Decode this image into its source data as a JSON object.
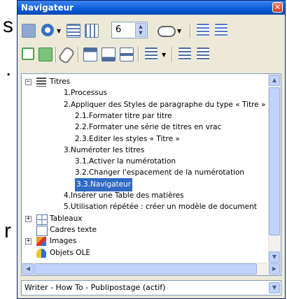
{
  "background_text": [
    "s",
    "r",
    "."
  ],
  "window": {
    "title": "Navigateur",
    "close_glyph": "✕"
  },
  "toolbar": {
    "row1": [
      {
        "name": "navigation-icon",
        "color": "#6c8ebf"
      },
      {
        "name": "navigation-circle-icon",
        "color": "#3a6fc6"
      },
      {
        "name": "headings-list-icon",
        "color": "#5b7fae"
      },
      {
        "name": "headings-grid-icon",
        "color": "#5b7fae"
      },
      {
        "name": "drag-mode-icon",
        "color": "#666666"
      },
      {
        "name": "promote-chapter-icon",
        "color": "#4c77c0"
      },
      {
        "name": "demote-chapter-icon",
        "color": "#4c77c0"
      }
    ],
    "outline_level": "6",
    "row2": [
      {
        "name": "toggle-icon",
        "color": "#4aa54a"
      },
      {
        "name": "reminder-icon",
        "color": "#3a8f3a"
      },
      {
        "name": "edit-icon",
        "color": "#777777"
      },
      {
        "name": "header-icon",
        "color": "#4c6c9c"
      },
      {
        "name": "footer-icon",
        "color": "#4c6c9c"
      },
      {
        "name": "anchor-icon",
        "color": "#4c6c9c"
      },
      {
        "name": "list-box-icon",
        "color": "#4c6c9c"
      },
      {
        "name": "promote-level-icon",
        "color": "#4c6c9c"
      },
      {
        "name": "demote-level-icon",
        "color": "#4c6c9c"
      }
    ]
  },
  "tree": {
    "items": [
      {
        "label": "Titres",
        "level": 0,
        "expander": "−",
        "icon": "headings-icon"
      },
      {
        "label": "1.Processus",
        "level": 1
      },
      {
        "label": "2.Appliquer des Styles de paragraphe du type « Titre »",
        "level": 1
      },
      {
        "label": "2.1.Formater titre par titre",
        "level": 2
      },
      {
        "label": "2.2.Formater une série de titres en vrac",
        "level": 2
      },
      {
        "label": "2.3.Editer les styles « Titre »",
        "level": 2
      },
      {
        "label": "3.Numéroter les titres",
        "level": 1
      },
      {
        "label": "3.1.Activer la numérotation",
        "level": 2
      },
      {
        "label": "3.2.Changer l'espacement de la numérotation",
        "level": 2
      },
      {
        "label": "3.3.Navigateur",
        "level": 2,
        "selected": true
      },
      {
        "label": "4.Insérer une Table des matières",
        "level": 1
      },
      {
        "label": "5.Utilisation répétée : créer un modèle de document",
        "level": 1
      },
      {
        "label": "Tableaux",
        "level": 0,
        "expander": "+",
        "icon": "table-icon"
      },
      {
        "label": "Cadres texte",
        "level": 0,
        "icon": "frame-icon"
      },
      {
        "label": "Images",
        "level": 0,
        "expander": "+",
        "icon": "image-icon"
      },
      {
        "label": "Objets OLE",
        "level": 0,
        "icon": "ole-object-icon"
      }
    ],
    "selected_color": "#316ac5"
  },
  "document_select": {
    "value": "Writer - How To - Publipostage (actif)"
  }
}
